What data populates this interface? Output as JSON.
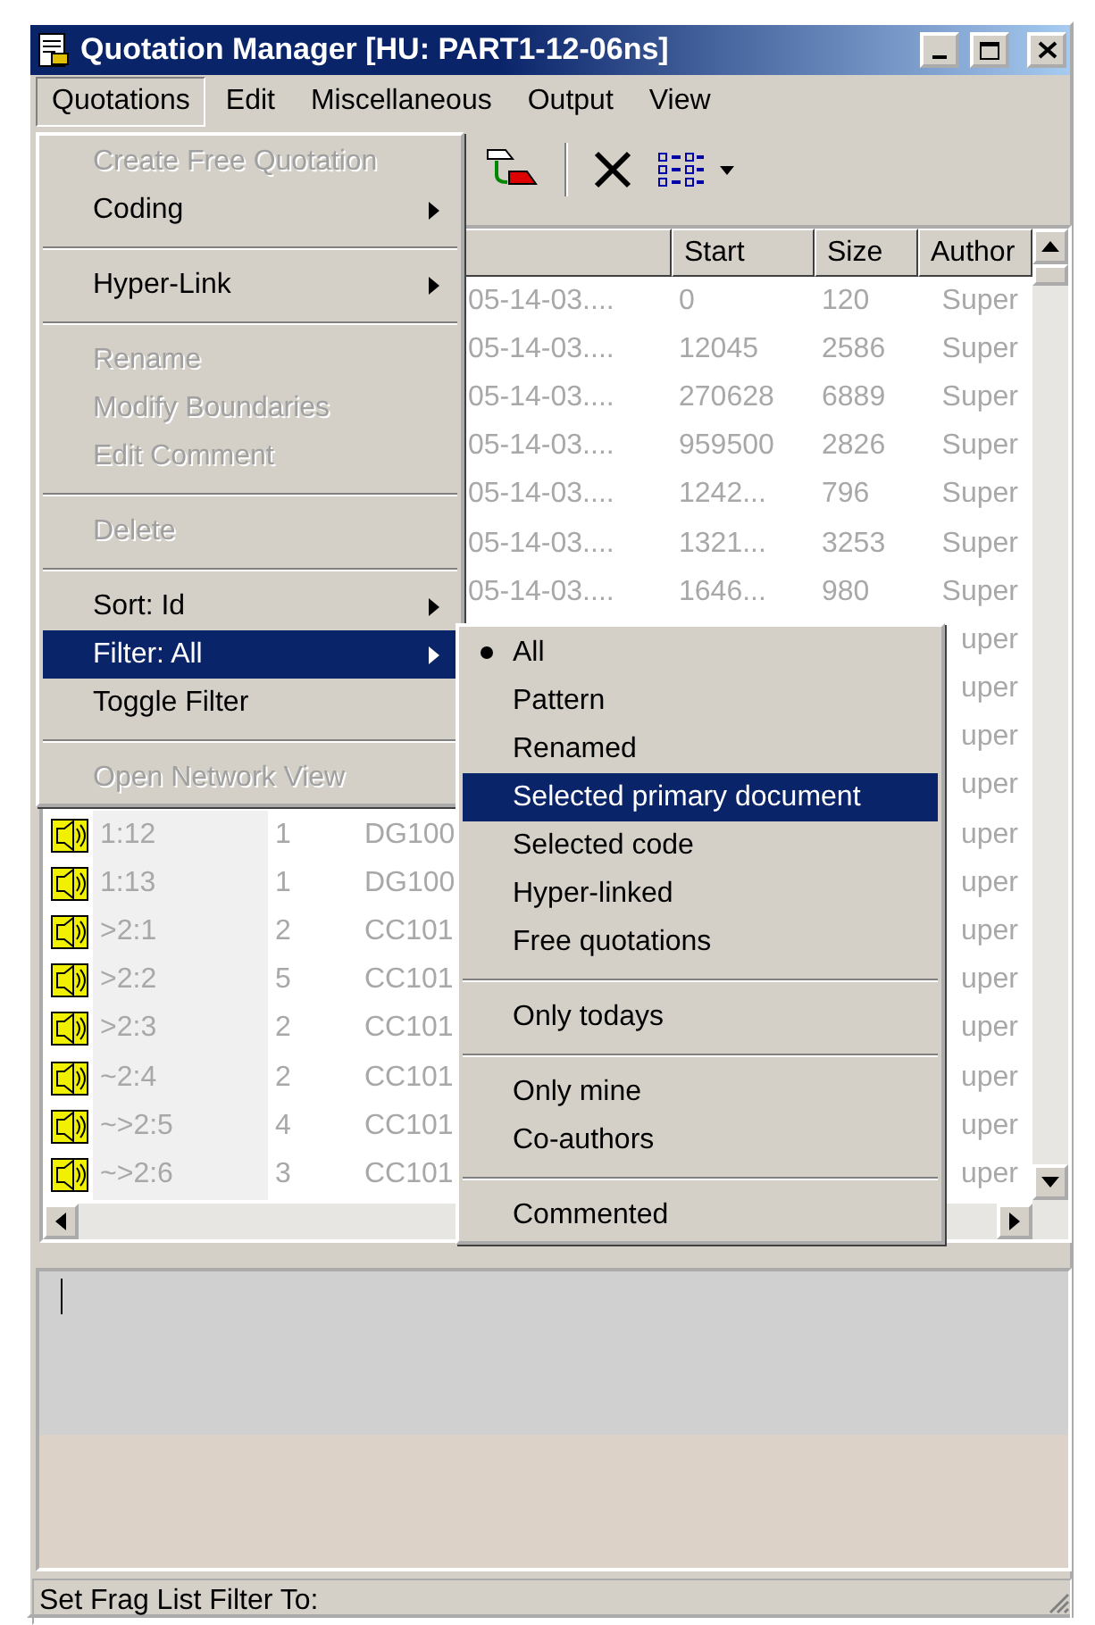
{
  "window": {
    "title": "Quotation Manager [HU: PART1-12-06ns]"
  },
  "menubar": [
    {
      "label": "Quotations",
      "selected": true
    },
    {
      "label": "Edit",
      "selected": false
    },
    {
      "label": "Miscellaneous",
      "selected": false
    },
    {
      "label": "Output",
      "selected": false
    },
    {
      "label": "View",
      "selected": false
    }
  ],
  "table": {
    "columns": [
      "Start",
      "Size",
      "Author"
    ],
    "rows": [
      {
        "date": "05-14-03....",
        "start": "0",
        "size": "120",
        "author": "Super"
      },
      {
        "date": "05-14-03....",
        "start": "12045",
        "size": "2586",
        "author": "Super"
      },
      {
        "date": "05-14-03....",
        "start": "270628",
        "size": "6889",
        "author": "Super"
      },
      {
        "date": "05-14-03....",
        "start": "959500",
        "size": "2826",
        "author": "Super"
      },
      {
        "date": "05-14-03....",
        "start": "1242...",
        "size": "796",
        "author": "Super"
      },
      {
        "date": "05-14-03....",
        "start": "1321...",
        "size": "3253",
        "author": "Super"
      },
      {
        "date": "05-14-03....",
        "start": "1646...",
        "size": "980",
        "author": "Super"
      },
      {
        "author": "uper"
      },
      {
        "author": "uper"
      },
      {
        "author": "uper"
      },
      {
        "author": "uper"
      },
      {
        "id": "1:12",
        "count": "1",
        "document": "DG100",
        "author": "uper"
      },
      {
        "id": "1:13",
        "count": "1",
        "document": "DG100",
        "author": "uper"
      },
      {
        "id": ">2:1",
        "count": "2",
        "document": "CC101",
        "author": "uper"
      },
      {
        "id": ">2:2",
        "count": "5",
        "document": "CC101",
        "author": "uper"
      },
      {
        "id": ">2:3",
        "count": "2",
        "document": "CC101",
        "author": "uper"
      },
      {
        "id": "~2:4",
        "count": "2",
        "document": "CC101",
        "author": "uper"
      },
      {
        "id": "~>2:5",
        "count": "4",
        "document": "CC101",
        "author": "uper"
      },
      {
        "id": "~>2:6",
        "count": "3",
        "document": "CC101",
        "author": "uper"
      }
    ]
  },
  "menu": [
    {
      "kind": "item",
      "label": "Create Free Quotation",
      "disabled": true,
      "submenu": false,
      "selected": false
    },
    {
      "kind": "item",
      "label": "Coding",
      "disabled": false,
      "submenu": true,
      "selected": false
    },
    {
      "kind": "separator"
    },
    {
      "kind": "item",
      "label": "Hyper-Link",
      "disabled": false,
      "submenu": true,
      "selected": false
    },
    {
      "kind": "separator"
    },
    {
      "kind": "item",
      "label": "Rename",
      "disabled": true,
      "submenu": false,
      "selected": false
    },
    {
      "kind": "item",
      "label": "Modify Boundaries",
      "disabled": true,
      "submenu": false,
      "selected": false
    },
    {
      "kind": "item",
      "label": "Edit Comment",
      "disabled": true,
      "submenu": false,
      "selected": false
    },
    {
      "kind": "separator"
    },
    {
      "kind": "item",
      "label": "Delete",
      "disabled": true,
      "submenu": false,
      "selected": false
    },
    {
      "kind": "separator"
    },
    {
      "kind": "item",
      "label": "Sort: Id",
      "disabled": false,
      "submenu": true,
      "selected": false
    },
    {
      "kind": "item",
      "label": "Filter: All",
      "disabled": false,
      "submenu": true,
      "selected": true
    },
    {
      "kind": "item",
      "label": "Toggle Filter",
      "disabled": false,
      "submenu": false,
      "selected": false
    },
    {
      "kind": "separator"
    },
    {
      "kind": "item",
      "label": "Open Network View",
      "disabled": true,
      "submenu": false,
      "selected": false
    }
  ],
  "submenu": [
    {
      "kind": "item",
      "label": "All",
      "checked": true,
      "selected": false
    },
    {
      "kind": "item",
      "label": "Pattern",
      "checked": false,
      "selected": false
    },
    {
      "kind": "item",
      "label": "Renamed",
      "checked": false,
      "selected": false
    },
    {
      "kind": "item",
      "label": "Selected primary document",
      "checked": false,
      "selected": true
    },
    {
      "kind": "item",
      "label": "Selected code",
      "checked": false,
      "selected": false
    },
    {
      "kind": "item",
      "label": "Hyper-linked",
      "checked": false,
      "selected": false
    },
    {
      "kind": "item",
      "label": "Free quotations",
      "checked": false,
      "selected": false
    },
    {
      "kind": "separator"
    },
    {
      "kind": "item",
      "label": "Only todays",
      "checked": false,
      "selected": false
    },
    {
      "kind": "separator"
    },
    {
      "kind": "item",
      "label": "Only mine",
      "checked": false,
      "selected": false
    },
    {
      "kind": "item",
      "label": "Co-authors",
      "checked": false,
      "selected": false
    },
    {
      "kind": "separator"
    },
    {
      "kind": "item",
      "label": "Commented",
      "checked": false,
      "selected": false
    }
  ],
  "status_bar": "Set Frag List Filter To:"
}
